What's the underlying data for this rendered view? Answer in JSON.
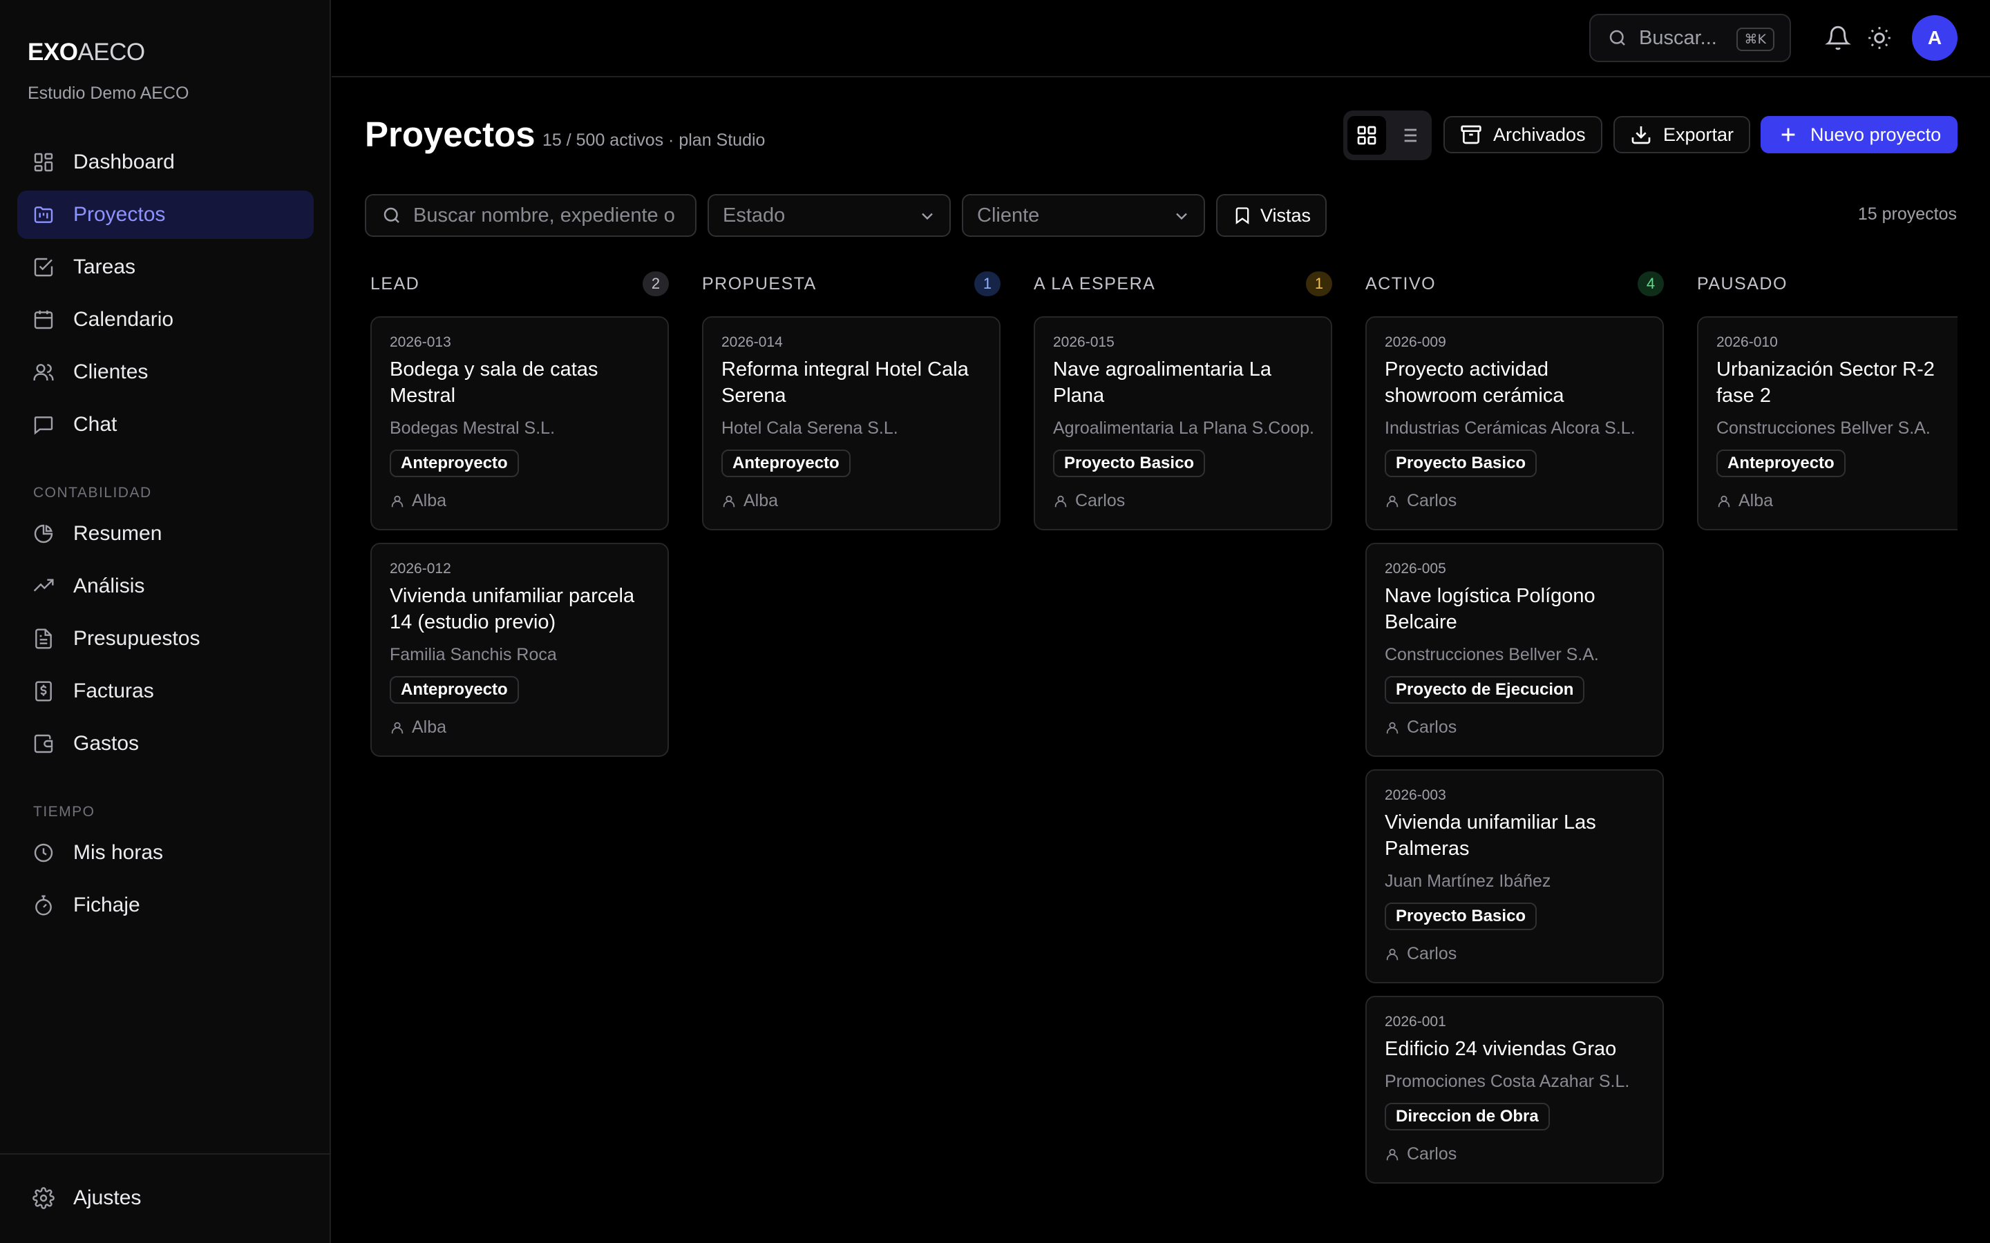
{
  "brand": {
    "part1": "EXO",
    "part2": "AECO"
  },
  "org_name": "Estudio Demo AECO",
  "nav": {
    "main": [
      {
        "label": "Dashboard",
        "icon": "dashboard-icon"
      },
      {
        "label": "Proyectos",
        "icon": "folder-kanban-icon",
        "active": true
      },
      {
        "label": "Tareas",
        "icon": "checkbox-icon"
      },
      {
        "label": "Calendario",
        "icon": "calendar-icon"
      },
      {
        "label": "Clientes",
        "icon": "users-icon"
      },
      {
        "label": "Chat",
        "icon": "chat-icon"
      }
    ],
    "contabilidad_label": "CONTABILIDAD",
    "contabilidad": [
      {
        "label": "Resumen",
        "icon": "pie-chart-icon"
      },
      {
        "label": "Análisis",
        "icon": "trend-icon"
      },
      {
        "label": "Presupuestos",
        "icon": "document-icon"
      },
      {
        "label": "Facturas",
        "icon": "invoice-icon"
      },
      {
        "label": "Gastos",
        "icon": "wallet-icon"
      }
    ],
    "tiempo_label": "TIEMPO",
    "tiempo": [
      {
        "label": "Mis horas",
        "icon": "clock-icon"
      },
      {
        "label": "Fichaje",
        "icon": "stopwatch-icon"
      }
    ],
    "footer": {
      "label": "Ajustes",
      "icon": "gear-icon"
    }
  },
  "topbar": {
    "search_placeholder": "Buscar...",
    "shortcut": "⌘K",
    "avatar_initial": "A"
  },
  "header": {
    "title": "Proyectos",
    "subtitle": "15 / 500 activos · plan Studio",
    "archived_label": "Archivados",
    "export_label": "Exportar",
    "new_label": "Nuevo proyecto"
  },
  "filters": {
    "search_placeholder": "Buscar nombre, expediente o",
    "estado_label": "Estado",
    "cliente_label": "Cliente",
    "vistas_label": "Vistas",
    "results": "15 proyectos"
  },
  "colors": {
    "accent": "#3b3df0",
    "lead": "#27272a",
    "propuesta": "#172554",
    "espera": "#3b2a07",
    "activo": "#0f2e1a"
  },
  "columns": [
    {
      "title": "LEAD",
      "count": "2",
      "badge_bg": "#26262a",
      "badge_fg": "#c4c4cc",
      "cards": [
        {
          "code": "2026-013",
          "title": "Bodega y sala de catas Mestral",
          "client": "Bodegas Mestral S.L.",
          "phase": "Anteproyecto",
          "owner": "Alba"
        },
        {
          "code": "2026-012",
          "title": "Vivienda unifamiliar parcela 14 (estudio previo)",
          "client": "Familia Sanchis Roca",
          "phase": "Anteproyecto",
          "owner": "Alba"
        }
      ]
    },
    {
      "title": "PROPUESTA",
      "count": "1",
      "badge_bg": "#162447",
      "badge_fg": "#8fb3ff",
      "cards": [
        {
          "code": "2026-014",
          "title": "Reforma integral Hotel Cala Serena",
          "client": "Hotel Cala Serena S.L.",
          "phase": "Anteproyecto",
          "owner": "Alba"
        }
      ]
    },
    {
      "title": "A LA ESPERA",
      "count": "1",
      "badge_bg": "#3a2b08",
      "badge_fg": "#f5c04a",
      "cards": [
        {
          "code": "2026-015",
          "title": "Nave agroalimentaria La Plana",
          "client": "Agroalimentaria La Plana S.Coop.",
          "phase": "Proyecto Basico",
          "owner": "Carlos"
        }
      ]
    },
    {
      "title": "ACTIVO",
      "count": "4",
      "badge_bg": "#0f2e1a",
      "badge_fg": "#5ee08a",
      "cards": [
        {
          "code": "2026-009",
          "title": "Proyecto actividad showroom cerámica",
          "client": "Industrias Cerámicas Alcora S.L.",
          "phase": "Proyecto Basico",
          "owner": "Carlos"
        },
        {
          "code": "2026-005",
          "title": "Nave logística Polígono Belcaire",
          "client": "Construcciones Bellver S.A.",
          "phase": "Proyecto de Ejecucion",
          "owner": "Carlos"
        },
        {
          "code": "2026-003",
          "title": "Vivienda unifamiliar Las Palmeras",
          "client": "Juan Martínez Ibáñez",
          "phase": "Proyecto Basico",
          "owner": "Carlos"
        },
        {
          "code": "2026-001",
          "title": "Edificio 24 viviendas Grao",
          "client": "Promociones Costa Azahar S.L.",
          "phase": "Direccion de Obra",
          "owner": "Carlos"
        }
      ]
    },
    {
      "title": "PAUSADO",
      "count": "",
      "badge_bg": "transparent",
      "badge_fg": "#c4c4cc",
      "cards": [
        {
          "code": "2026-010",
          "title": "Urbanización Sector R-2 fase 2",
          "client": "Construcciones Bellver S.A.",
          "phase": "Anteproyecto",
          "owner": "Alba"
        }
      ]
    }
  ]
}
